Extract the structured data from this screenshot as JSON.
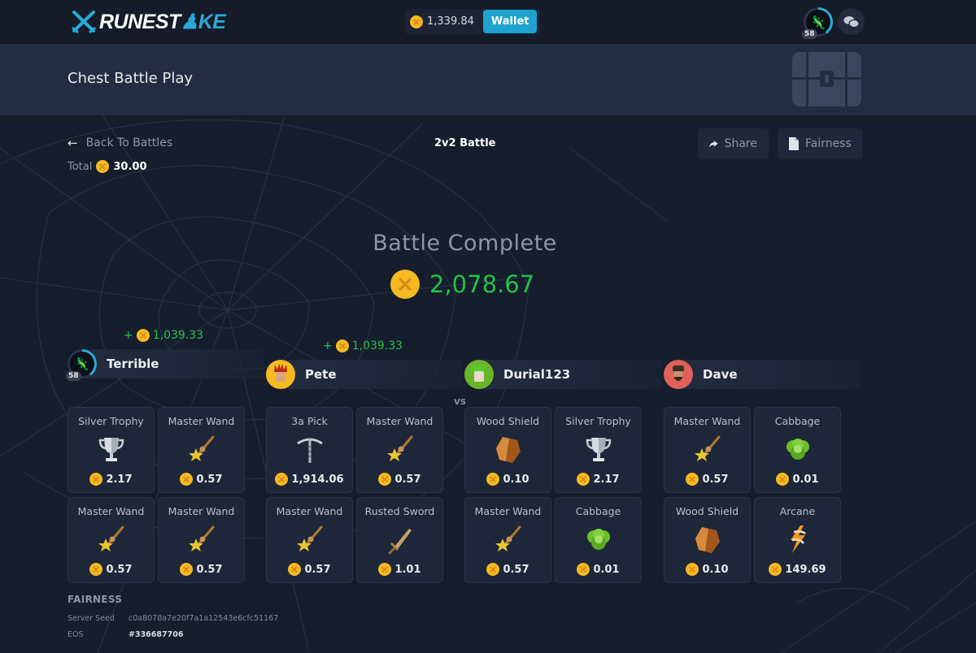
{
  "topbar": {
    "logo_text_a": "RUNEST",
    "logo_text_b": "KE",
    "balance": "1,339.84",
    "wallet_label": "Wallet",
    "user_level": "58",
    "chat_icon": "chat-bubbles-icon"
  },
  "header": {
    "title": "Chest Battle Play",
    "icon": "treasure-chest-icon"
  },
  "battle": {
    "back_label": "Back To Battles",
    "total_label": "Total",
    "total_value": "30.00",
    "type_label": "2v2 Battle",
    "share_label": "Share",
    "fairness_label": "Fairness",
    "complete_title": "Battle Complete",
    "complete_value": "2,078.67",
    "vs_label": "VS"
  },
  "players": [
    {
      "name": "Terrible",
      "level": "58",
      "avatar": "lizard-avatar",
      "winnings": "1,039.33",
      "items": [
        {
          "name": "Silver Trophy",
          "price": "2.17",
          "icon": "trophy"
        },
        {
          "name": "Master Wand",
          "price": "0.57",
          "icon": "wand"
        },
        {
          "name": "Master Wand",
          "price": "0.57",
          "icon": "wand"
        },
        {
          "name": "Master Wand",
          "price": "0.57",
          "icon": "wand"
        }
      ]
    },
    {
      "name": "Pete",
      "avatar": "crown-avatar",
      "winnings": "1,039.33",
      "items": [
        {
          "name": "3a Pick",
          "price": "1,914.06",
          "icon": "pickaxe"
        },
        {
          "name": "Master Wand",
          "price": "0.57",
          "icon": "wand"
        },
        {
          "name": "Master Wand",
          "price": "0.57",
          "icon": "wand"
        },
        {
          "name": "Rusted Sword",
          "price": "1.01",
          "icon": "sword"
        }
      ]
    },
    {
      "name": "Durial123",
      "avatar": "green-hair-avatar",
      "items": [
        {
          "name": "Wood Shield",
          "price": "0.10",
          "icon": "shield"
        },
        {
          "name": "Silver Trophy",
          "price": "2.17",
          "icon": "trophy"
        },
        {
          "name": "Master Wand",
          "price": "0.57",
          "icon": "wand"
        },
        {
          "name": "Cabbage",
          "price": "0.01",
          "icon": "cabbage"
        }
      ]
    },
    {
      "name": "Dave",
      "avatar": "bearded-avatar",
      "items": [
        {
          "name": "Master Wand",
          "price": "0.57",
          "icon": "wand"
        },
        {
          "name": "Cabbage",
          "price": "0.01",
          "icon": "cabbage"
        },
        {
          "name": "Wood Shield",
          "price": "0.10",
          "icon": "shield"
        },
        {
          "name": "Arcane",
          "price": "149.69",
          "icon": "arcane"
        }
      ]
    }
  ],
  "fairness": {
    "title": "FAIRNESS",
    "server_seed_label": "Server Seed",
    "server_seed": "c0a8078a7e20f7a1a12543e6cfc51167",
    "eos_label": "EOS",
    "eos_value": "#336687706"
  },
  "colors": {
    "accent": "#1ea3cf",
    "win_green": "#22c243",
    "coin": "#f5b921",
    "background": "#161e2e"
  }
}
